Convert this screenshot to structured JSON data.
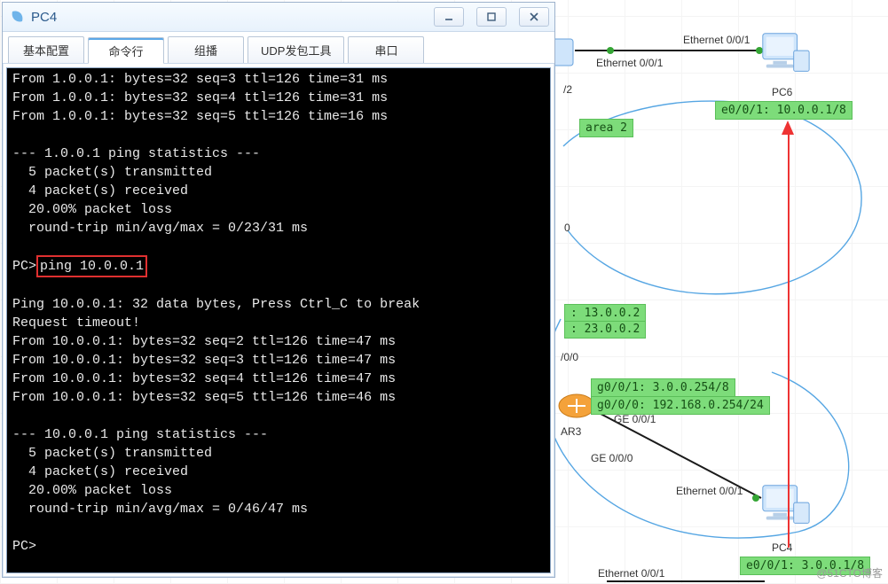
{
  "window": {
    "title": "PC4",
    "tabs": [
      "基本配置",
      "命令行",
      "组播",
      "UDP发包工具",
      "串口"
    ],
    "active_tab_index": 1
  },
  "terminal": {
    "lines_top": [
      "From 1.0.0.1: bytes=32 seq=3 ttl=126 time=31 ms",
      "From 1.0.0.1: bytes=32 seq=4 ttl=126 time=31 ms",
      "From 1.0.0.1: bytes=32 seq=5 ttl=126 time=16 ms",
      "",
      "--- 1.0.0.1 ping statistics ---",
      "  5 packet(s) transmitted",
      "  4 packet(s) received",
      "  20.00% packet loss",
      "  round-trip min/avg/max = 0/23/31 ms",
      ""
    ],
    "prompt_line_prefix": "PC>",
    "highlighted_command": "ping 10.0.0.1",
    "lines_bottom": [
      "",
      "Ping 10.0.0.1: 32 data bytes, Press Ctrl_C to break",
      "Request timeout!",
      "From 10.0.0.1: bytes=32 seq=2 ttl=126 time=47 ms",
      "From 10.0.0.1: bytes=32 seq=3 ttl=126 time=47 ms",
      "From 10.0.0.1: bytes=32 seq=4 ttl=126 time=47 ms",
      "From 10.0.0.1: bytes=32 seq=5 ttl=126 time=46 ms",
      "",
      "--- 10.0.0.1 ping statistics ---",
      "  5 packet(s) transmitted",
      "  4 packet(s) received",
      "  20.00% packet loss",
      "  round-trip min/avg/max = 0/46/47 ms",
      "",
      "PC>"
    ]
  },
  "topology": {
    "labels": {
      "area2": "area 2",
      "pc6_if": "e0/0/1: 10.0.0.1/8",
      "pc4_if": "e0/0/1: 3.0.0.1/8",
      "ar3_g001": "g0/0/1: 3.0.0.254/8",
      "ar3_g000": "g0/0/0: 192.168.0.254/24",
      "mid_line1": ": 13.0.0.2",
      "mid_line2": ": 23.0.0.2",
      "eth001_top_right": "Ethernet 0/0/1",
      "eth001_top_mid": "Ethernet 0/0/1",
      "eth001_pc4": "Ethernet 0/0/1",
      "eth001_bottom": "Ethernet 0/0/1",
      "ge001": "GE 0/0/1",
      "ge000": "GE 0/0/0",
      "if_000": "/0/0",
      "pc6": "PC6",
      "pc4": "PC4",
      "ar3": "AR3",
      "slash2": "/2",
      "zero": "0"
    }
  },
  "watermark": "@51CTO博客"
}
